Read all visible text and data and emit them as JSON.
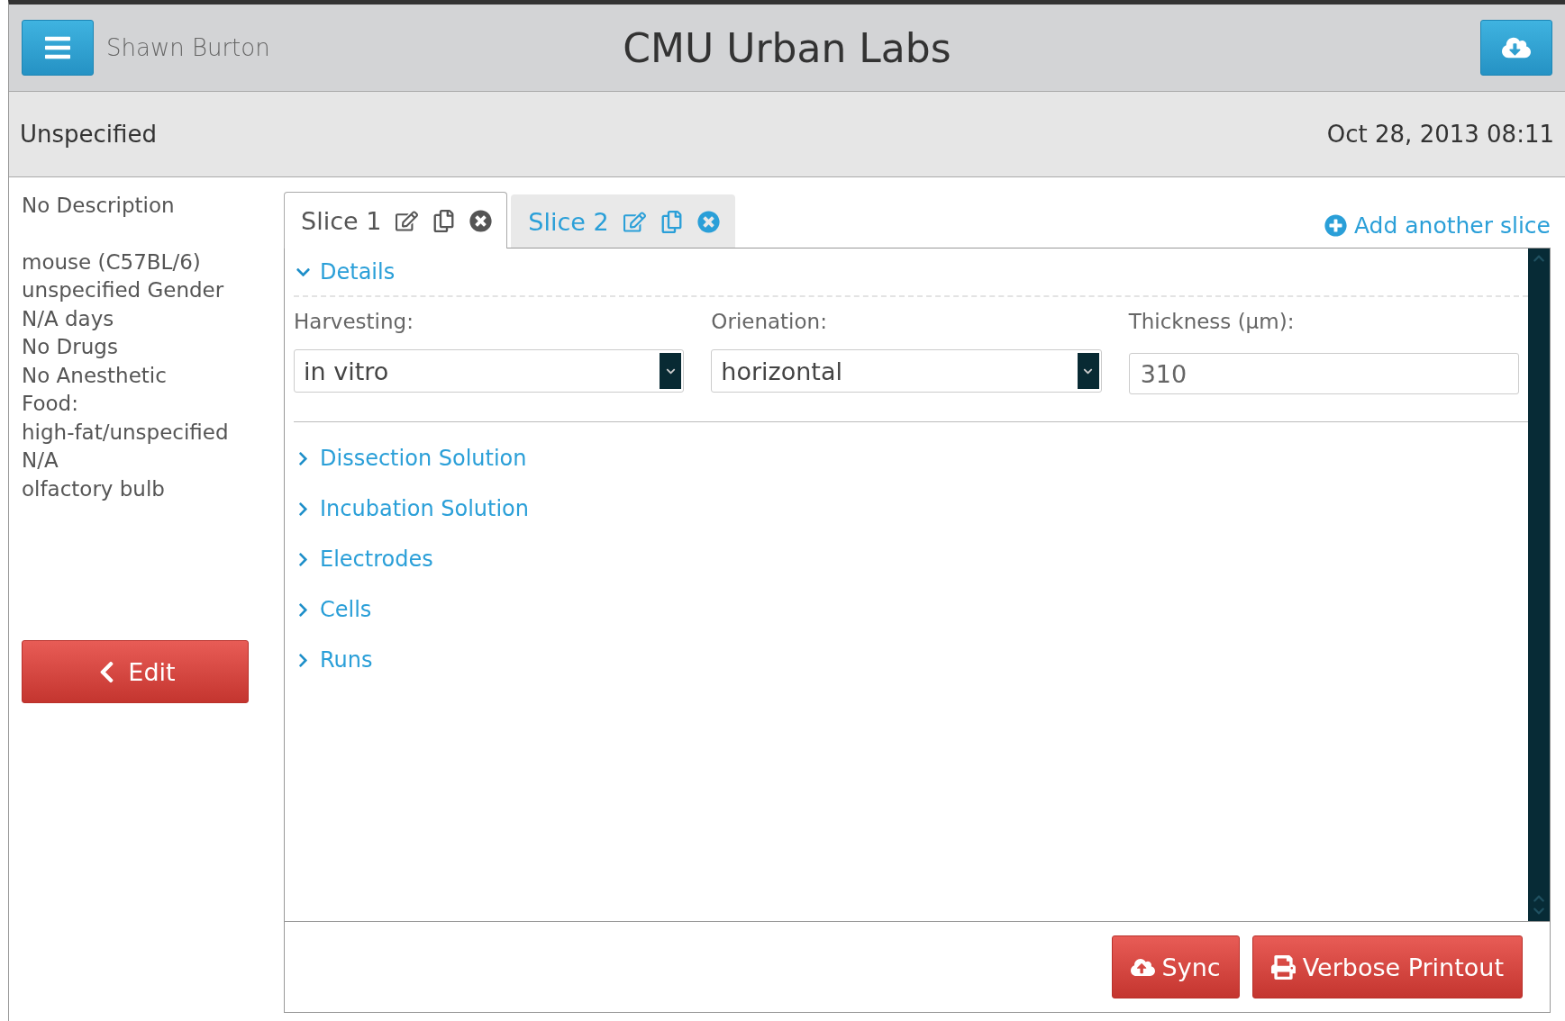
{
  "header": {
    "user": "Shawn Burton",
    "title": "CMU Urban Labs"
  },
  "subheader": {
    "name": "Unspecified",
    "date": "Oct 28, 2013 08:11"
  },
  "sidebar": {
    "description": "No Description",
    "details": [
      "mouse (C57BL/6)",
      "unspecified Gender",
      "N/A days",
      "No Drugs",
      "No Anesthetic",
      "Food:",
      "high-fat/unspecified",
      "N/A",
      "olfactory bulb"
    ],
    "edit_button": "Edit"
  },
  "tabs": [
    {
      "label": "Slice 1",
      "selected": true
    },
    {
      "label": "Slice 2",
      "selected": false
    }
  ],
  "add_slice": "Add another slice",
  "sections": [
    {
      "title": "Details",
      "expanded": true,
      "fields": [
        {
          "kind": "select",
          "label": "Harvesting:",
          "value": "in vitro"
        },
        {
          "kind": "select",
          "label": "Orienation:",
          "value": "horizontal"
        },
        {
          "kind": "input",
          "label": "Thickness (µm):",
          "value": "310"
        }
      ]
    },
    {
      "title": "Dissection Solution",
      "expanded": false
    },
    {
      "title": "Incubation Solution",
      "expanded": false
    },
    {
      "title": "Electrodes",
      "expanded": false
    },
    {
      "title": "Cells",
      "expanded": false
    },
    {
      "title": "Runs",
      "expanded": false
    }
  ],
  "buttons": [
    "Sync",
    "Verbose Printout"
  ]
}
